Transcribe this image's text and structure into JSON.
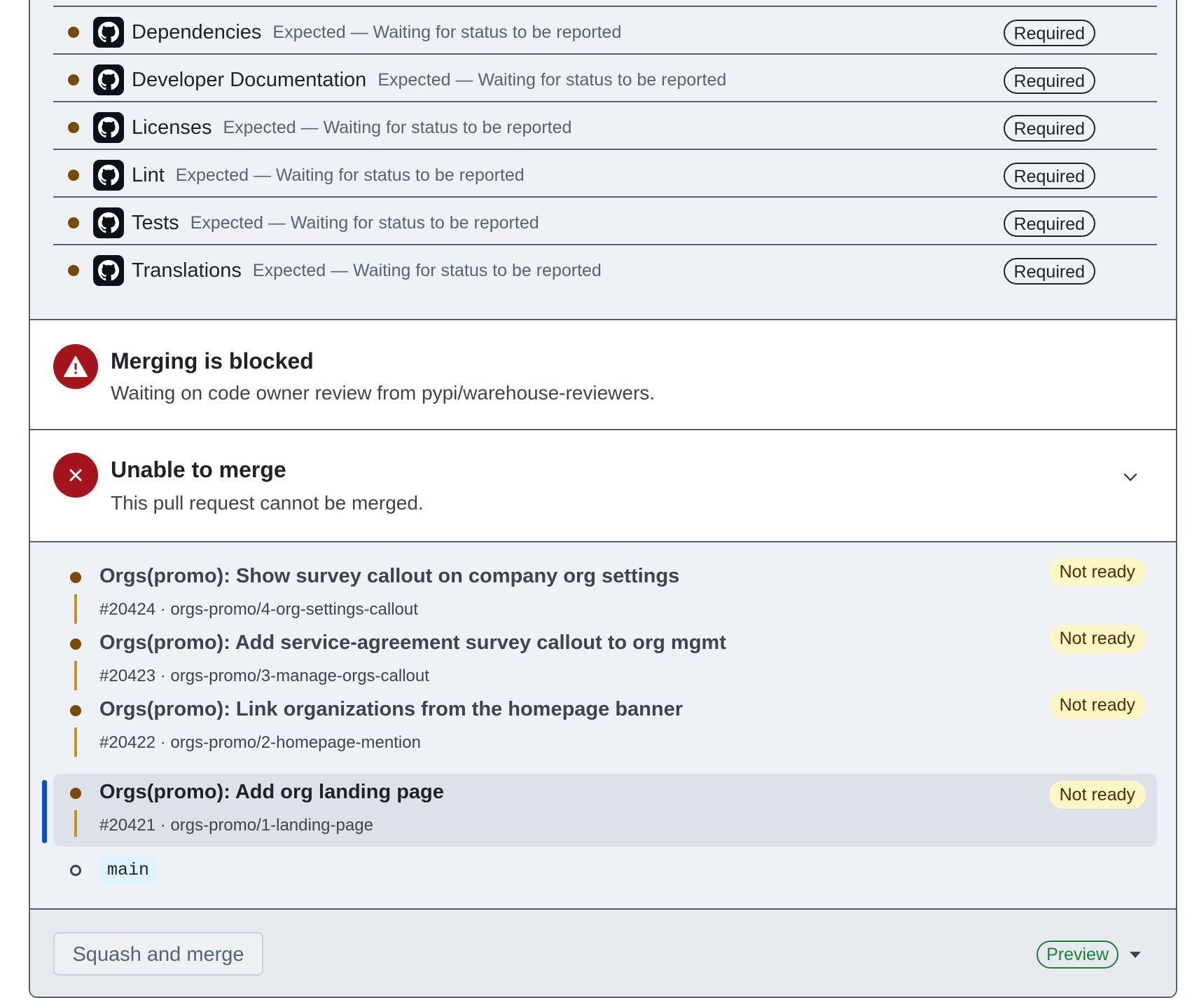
{
  "checks": [
    {
      "name": "Dependencies",
      "desc": "Expected — Waiting for status to be reported",
      "badge": "Required"
    },
    {
      "name": "Developer Documentation",
      "desc": "Expected — Waiting for status to be reported",
      "badge": "Required"
    },
    {
      "name": "Licenses",
      "desc": "Expected — Waiting for status to be reported",
      "badge": "Required"
    },
    {
      "name": "Lint",
      "desc": "Expected — Waiting for status to be reported",
      "badge": "Required"
    },
    {
      "name": "Tests",
      "desc": "Expected — Waiting for status to be reported",
      "badge": "Required"
    },
    {
      "name": "Translations",
      "desc": "Expected — Waiting for status to be reported",
      "badge": "Required"
    }
  ],
  "blocked": {
    "icon": "alert-icon",
    "title": "Merging is blocked",
    "subtitle": "Waiting on code owner review from pypi/warehouse-reviewers."
  },
  "unable": {
    "icon": "x-icon",
    "title": "Unable to merge",
    "subtitle": "This pull request cannot be merged."
  },
  "stack": [
    {
      "title": "Orgs(promo): Show survey callout on company org settings",
      "meta": "#20424 · orgs-promo/4-org-settings-callout",
      "badge": "Not ready"
    },
    {
      "title": "Orgs(promo): Add service-agreement survey callout to org mgmt",
      "meta": "#20423 · orgs-promo/3-manage-orgs-callout",
      "badge": "Not ready"
    },
    {
      "title": "Orgs(promo): Link organizations from the homepage banner",
      "meta": "#20422 · orgs-promo/2-homepage-mention",
      "badge": "Not ready"
    },
    {
      "title": "Orgs(promo): Add org landing page",
      "meta": "#20421 · orgs-promo/1-landing-page",
      "badge": "Not ready"
    }
  ],
  "base_branch": "main",
  "footer": {
    "merge_label": "Squash and merge",
    "preview_label": "Preview"
  },
  "colors": {
    "pending_dot": "#7a4a03",
    "danger": "#a5131d",
    "active_bar": "#0b4dc4",
    "preview_green": "#1a7f37",
    "badge_bg": "#fff6c6"
  }
}
